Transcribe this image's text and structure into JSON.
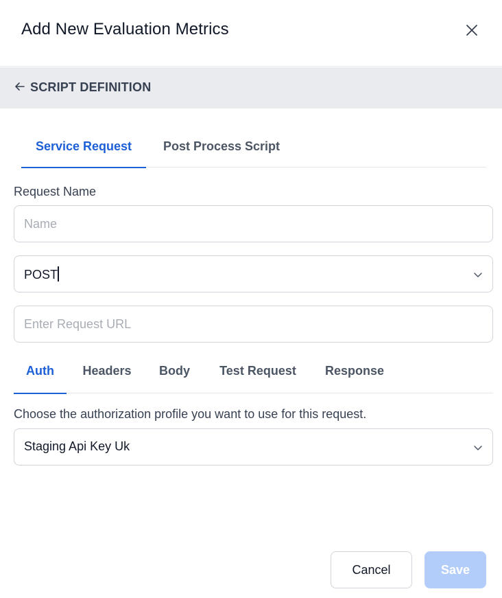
{
  "dialog": {
    "title": "Add New Evaluation Metrics"
  },
  "icons": {
    "close": "close-icon",
    "back": "arrow-left-icon",
    "chevron": "chevron-down-icon"
  },
  "section": {
    "title": "SCRIPT DEFINITION"
  },
  "top_tabs": [
    {
      "label": "Service Request",
      "active": true
    },
    {
      "label": "Post Process Script",
      "active": false
    }
  ],
  "form": {
    "request_name_label": "Request Name",
    "request_name_placeholder": "Name",
    "request_name_value": "",
    "method_value": "POST",
    "url_placeholder": "Enter Request URL",
    "url_value": ""
  },
  "sub_tabs": [
    {
      "label": "Auth",
      "active": true
    },
    {
      "label": "Headers",
      "active": false
    },
    {
      "label": "Body",
      "active": false
    },
    {
      "label": "Test Request",
      "active": false
    },
    {
      "label": "Response",
      "active": false
    }
  ],
  "auth": {
    "description": "Choose the authorization profile you want to use for this request.",
    "profile_value": "Staging Api Key Uk"
  },
  "footer": {
    "cancel_label": "Cancel",
    "save_label": "Save"
  },
  "colors": {
    "accent": "#1d5fd6",
    "save_disabled_bg": "#b3cdfb",
    "section_bar_bg": "#e9ebef"
  }
}
